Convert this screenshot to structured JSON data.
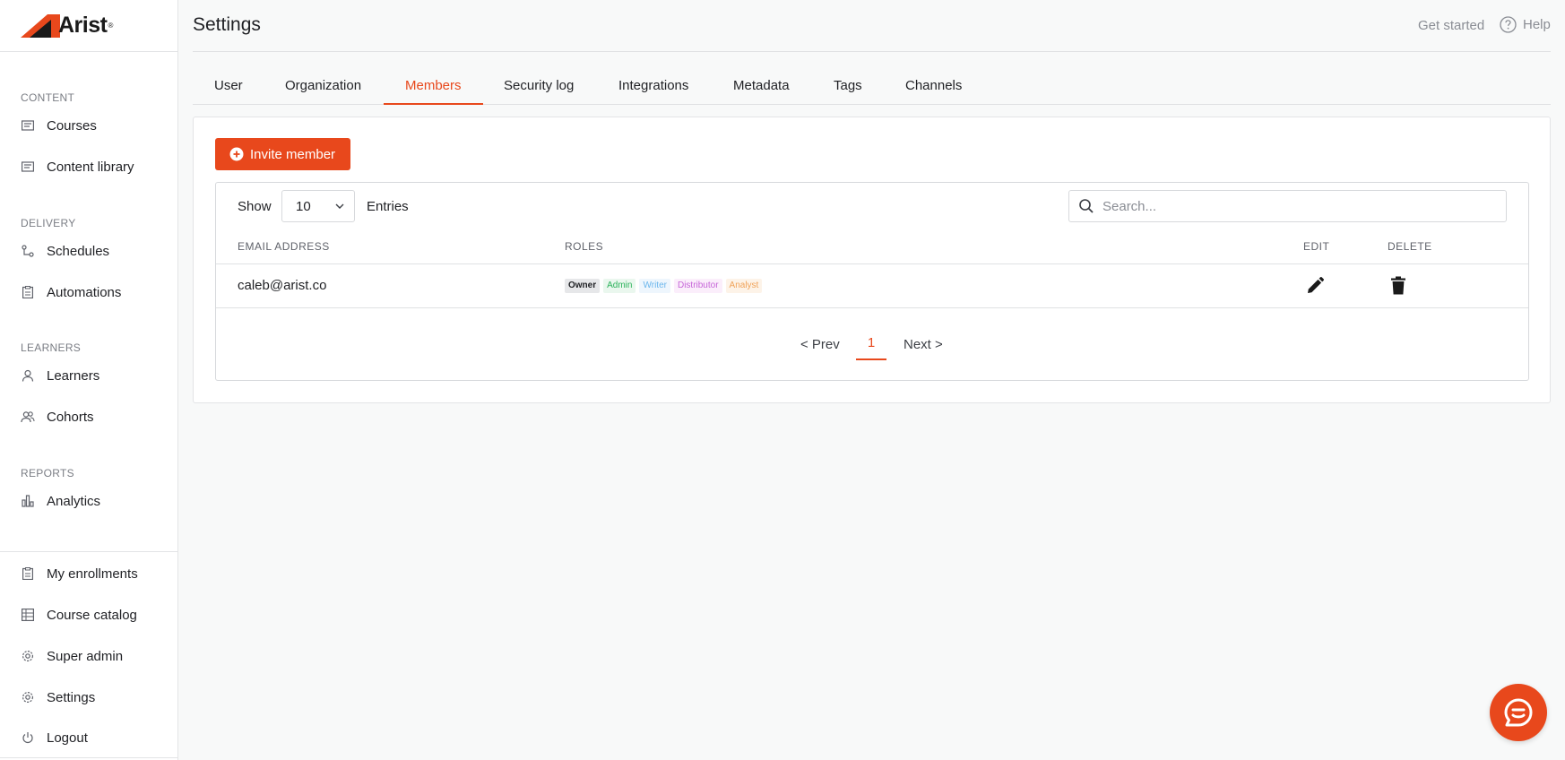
{
  "app": {
    "logo_text": "Arist",
    "logo_mark": "®"
  },
  "sidebar": {
    "sections": [
      {
        "heading": "CONTENT",
        "items": [
          {
            "label": "Courses",
            "icon": "courses-icon"
          },
          {
            "label": "Content library",
            "icon": "library-icon"
          }
        ]
      },
      {
        "heading": "DELIVERY",
        "items": [
          {
            "label": "Schedules",
            "icon": "schedule-icon"
          },
          {
            "label": "Automations",
            "icon": "clipboard-icon"
          }
        ]
      },
      {
        "heading": "LEARNERS",
        "items": [
          {
            "label": "Learners",
            "icon": "user-icon"
          },
          {
            "label": "Cohorts",
            "icon": "users-icon"
          }
        ]
      },
      {
        "heading": "REPORTS",
        "items": [
          {
            "label": "Analytics",
            "icon": "bar-chart-icon"
          }
        ]
      }
    ],
    "bottom_items": [
      {
        "label": "My enrollments",
        "icon": "clipboard-icon"
      },
      {
        "label": "Course catalog",
        "icon": "catalog-icon"
      },
      {
        "label": "Super admin",
        "icon": "gear-icon"
      },
      {
        "label": "Settings",
        "icon": "gear-icon"
      },
      {
        "label": "Logout",
        "icon": "power-icon"
      }
    ]
  },
  "header": {
    "title": "Settings",
    "get_started": "Get started",
    "help": "Help"
  },
  "tabs": [
    {
      "label": "User"
    },
    {
      "label": "Organization"
    },
    {
      "label": "Members",
      "active": true
    },
    {
      "label": "Security log"
    },
    {
      "label": "Integrations"
    },
    {
      "label": "Metadata"
    },
    {
      "label": "Tags"
    },
    {
      "label": "Channels"
    }
  ],
  "members": {
    "invite_label": "Invite member",
    "show_label": "Show",
    "entries_value": "10",
    "entries_label": "Entries",
    "search_placeholder": "Search...",
    "columns": {
      "email": "EMAIL ADDRESS",
      "roles": "ROLES",
      "edit": "EDIT",
      "delete": "DELETE"
    },
    "rows": [
      {
        "email": "caleb@arist.co",
        "roles": [
          {
            "label": "Owner",
            "bg": "#e6e7e9",
            "fg": "#1f2024"
          },
          {
            "label": "Admin",
            "bg": "#eaf7ee",
            "fg": "#2bb25a"
          },
          {
            "label": "Writer",
            "bg": "#eef6fd",
            "fg": "#6bb6ec"
          },
          {
            "label": "Distributor",
            "bg": "#fbeefb",
            "fg": "#c665d8"
          },
          {
            "label": "Analyst",
            "bg": "#fdf3e8",
            "fg": "#f0a35a"
          }
        ]
      }
    ],
    "pagination": {
      "prev": "< Prev",
      "current": "1",
      "next": "Next >"
    }
  },
  "colors": {
    "accent": "#e8481c"
  }
}
